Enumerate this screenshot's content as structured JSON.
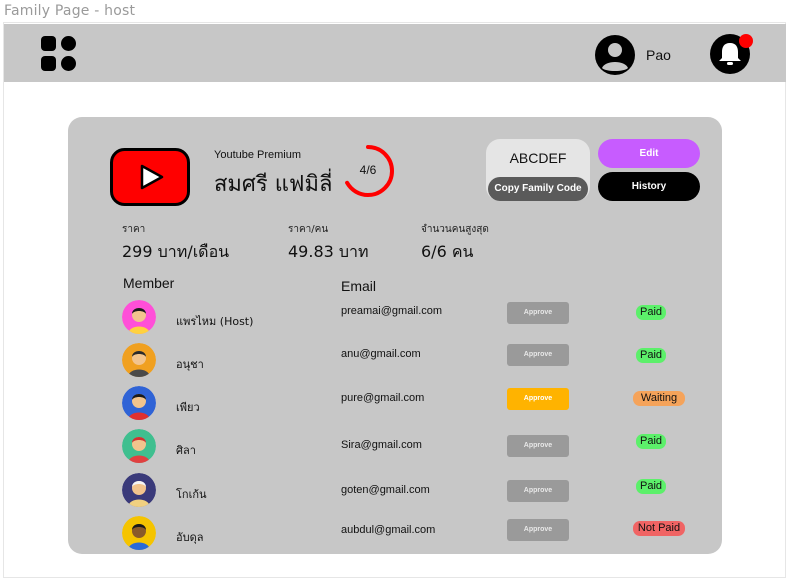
{
  "window": {
    "title": "Family Page - host"
  },
  "header": {
    "username": "Pao"
  },
  "family": {
    "service": "Youtube Premium",
    "name": "สมศรี แฟมิลี่",
    "members_progress": "4/6",
    "members_fraction": 0.667,
    "code": "ABCDEF",
    "copy_label": "Copy Family Code",
    "edit_label": "Edit",
    "history_label": "History"
  },
  "stats": {
    "price_label": "ราคา",
    "price_value": "299 บาท/เดือน",
    "per_person_label": "ราคา/คน",
    "per_person_value": "49.83 บาท",
    "max_label": "จำนวนคนสูงสุด",
    "max_value": "6/6 คน"
  },
  "table": {
    "member_header": "Member",
    "email_header": "Email",
    "approve_label": "Approve",
    "rows": [
      {
        "name": "แพรไหม (Host)",
        "email": "preamai@gmail.com",
        "status": "Paid",
        "approve_active": false
      },
      {
        "name": "อนุชา",
        "email": "anu@gmail.com",
        "status": "Paid",
        "approve_active": false
      },
      {
        "name": "เพียว",
        "email": "pure@gmail.com",
        "status": "Waiting",
        "approve_active": true
      },
      {
        "name": "ศิลา",
        "email": "Sira@gmail.com",
        "status": "Paid",
        "approve_active": false
      },
      {
        "name": "โกเก้น",
        "email": "goten@gmail.com",
        "status": "Paid",
        "approve_active": false
      },
      {
        "name": "อับดุล",
        "email": "aubdul@gmail.com",
        "status": "Not Paid",
        "approve_active": false
      }
    ]
  },
  "colors": {
    "paid": "#5cf06a",
    "waiting": "#f5a35a",
    "not_paid": "#f06464",
    "approve_active": "#ffb300",
    "edit": "#c75cff",
    "notification": "#ff0000"
  }
}
